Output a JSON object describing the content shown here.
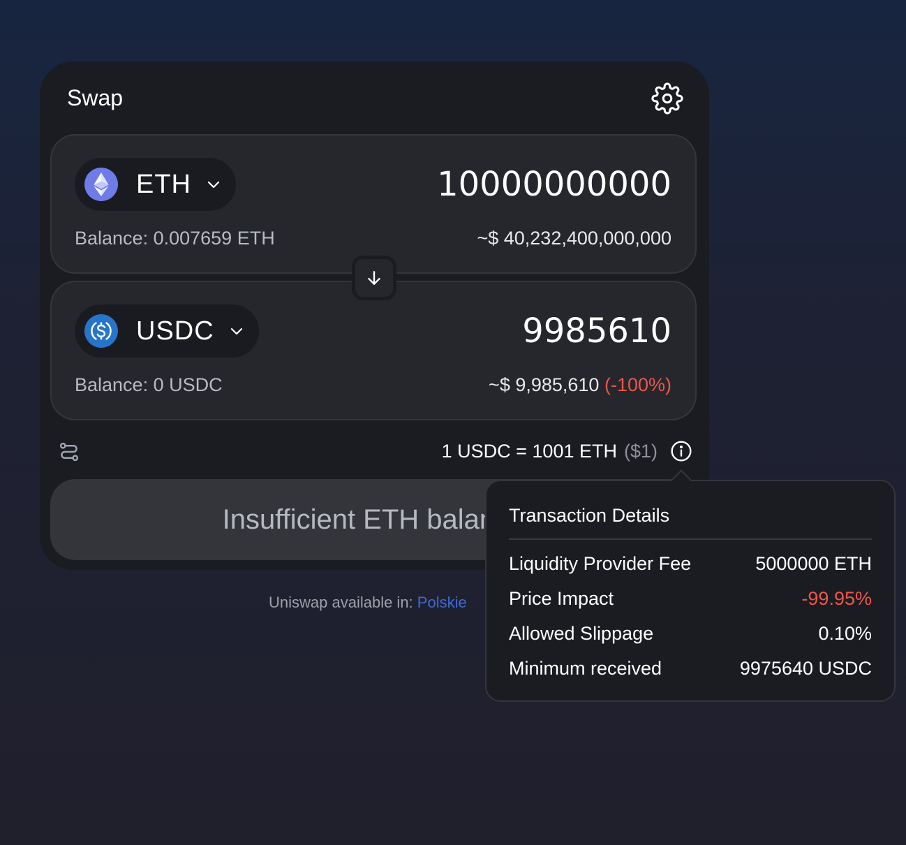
{
  "card": {
    "title": "Swap",
    "settings_icon": "gear-icon"
  },
  "from": {
    "token": "ETH",
    "token_icon": "eth-logo-icon",
    "amount": "10000000000",
    "balance": "Balance: 0.007659 ETH",
    "usd_value": "~$ 40,232,400,000,000"
  },
  "to": {
    "token": "USDC",
    "token_icon": "usdc-logo-icon",
    "amount": "9985610",
    "balance": "Balance: 0 USDC",
    "usd_value": "~$ 9,985,610",
    "price_impact": "(-100%)"
  },
  "rate": {
    "text": "1 USDC = 1001 ETH",
    "usd": "($1)"
  },
  "action_button": {
    "label": "Insufficient ETH balance"
  },
  "footer": {
    "text": "Uniswap available in:",
    "link": "Polskie"
  },
  "tooltip": {
    "title": "Transaction Details",
    "rows": [
      {
        "label": "Liquidity Provider Fee",
        "value": "5000000 ETH"
      },
      {
        "label": "Price Impact",
        "value": "-99.95%"
      },
      {
        "label": "Allowed Slippage",
        "value": "0.10%"
      },
      {
        "label": "Minimum received",
        "value": "9975640 USDC"
      }
    ]
  },
  "colors": {
    "negative": "#f0554b",
    "link": "#3e6ad8",
    "eth_logo": "#6f7ce8",
    "usdc_logo": "#2775ca"
  }
}
